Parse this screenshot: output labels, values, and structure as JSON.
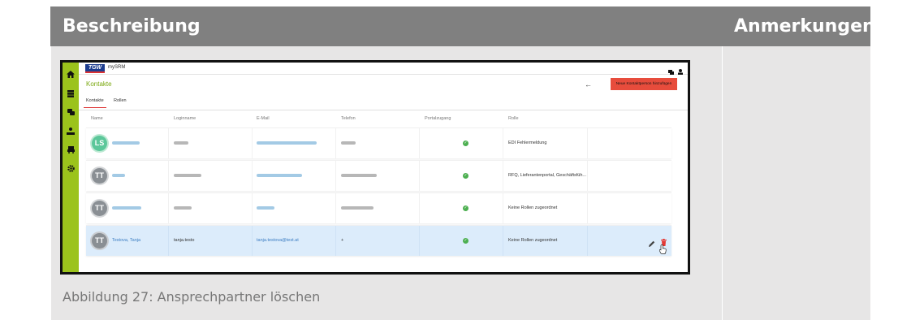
{
  "header": {
    "beschreibung": "Beschreibung",
    "anmerkungen": "Anmerkungen"
  },
  "caption": "Abbildung 27: Ansprechpartner löschen",
  "screenshot": {
    "logo_text": "TGW",
    "app_name": "mySRM",
    "page_title": "Kontakte",
    "back_arrow": "←",
    "add_button": "Neue Kontaktperson hinzufügen",
    "tabs": [
      "Kontakte",
      "Rollen"
    ],
    "columns": [
      "Name",
      "Loginname",
      "E-Mail",
      "Telefon",
      "Portalzugang",
      "Rolle"
    ],
    "rows": [
      {
        "initials": "LS",
        "avatar_color": "#5cc79a",
        "role": "EDI Fehlermeldung"
      },
      {
        "initials": "TT",
        "avatar_color": "#8a8f94",
        "role": "RFQ, Lieferantenportal, Geschäftsfüh..."
      },
      {
        "initials": "TT",
        "avatar_color": "#8a8f94",
        "role": "Keine Rollen zugeordnet"
      },
      {
        "initials": "TT",
        "avatar_color": "#8a8f94",
        "name": "Testova, Tanja",
        "login": "tanja.testo",
        "email": "tanja.testova@test.at",
        "phone": "+",
        "role": "Keine Rollen zugeordnet"
      }
    ],
    "rail_icons": [
      "home-icon",
      "database-icon",
      "chat-icon",
      "person-hand-icon",
      "car-icon",
      "gear-icon"
    ],
    "colors": {
      "accent": "#9bc31c",
      "button": "#e74c3c",
      "highlight_row": "#dcecfb",
      "header": "#808080"
    }
  }
}
